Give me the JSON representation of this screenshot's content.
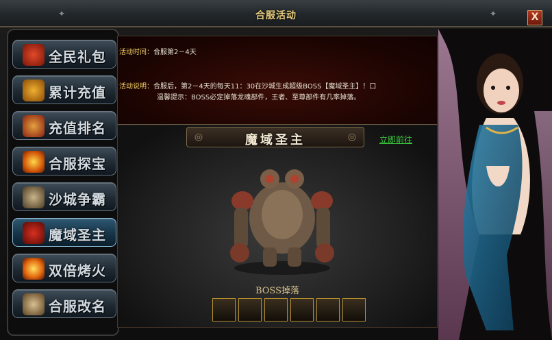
{
  "window": {
    "title": "合服活动",
    "close_label": "X"
  },
  "sidebar": {
    "items": [
      {
        "label": "全民礼包",
        "icon": "gift-icon",
        "active": false
      },
      {
        "label": "累计充值",
        "icon": "treasure-bag-icon",
        "active": false
      },
      {
        "label": "充值排名",
        "icon": "scroll-banner-icon",
        "active": false
      },
      {
        "label": "合服探宝",
        "icon": "gold-orb-icon",
        "active": false
      },
      {
        "label": "沙城争霸",
        "icon": "castle-icon",
        "active": false
      },
      {
        "label": "魔域圣主",
        "icon": "demon-mask-icon",
        "active": true
      },
      {
        "label": "双倍烤火",
        "icon": "campfire-icon",
        "active": false
      },
      {
        "label": "合服改名",
        "icon": "quill-book-icon",
        "active": false
      }
    ]
  },
  "info": {
    "time_label": "活动时间：",
    "time_value": "合服第2－4天",
    "desc_label": "活动说明：",
    "desc_line1": "合服后，第2－4天的每天11：30在沙城生成超级BOSS【魔域圣主】！口",
    "desc_line2": "温馨提示：BOSS必定掉落龙魂部件，王者、至尊部件有几率掉落。"
  },
  "boss": {
    "name": "魔域圣主",
    "go_link": "立即前往",
    "drop_label": "BOSS掉落",
    "drops": [
      "dragon-soul-part-icon",
      "weapon-part-icon",
      "claw-part-icon",
      "wing-part-icon",
      "gauntlet-part-icon",
      "crown-part-icon"
    ]
  },
  "colors": {
    "accent_gold": "#e8cc7c",
    "link_green": "#3ac83a",
    "info_key": "#f2d060"
  }
}
